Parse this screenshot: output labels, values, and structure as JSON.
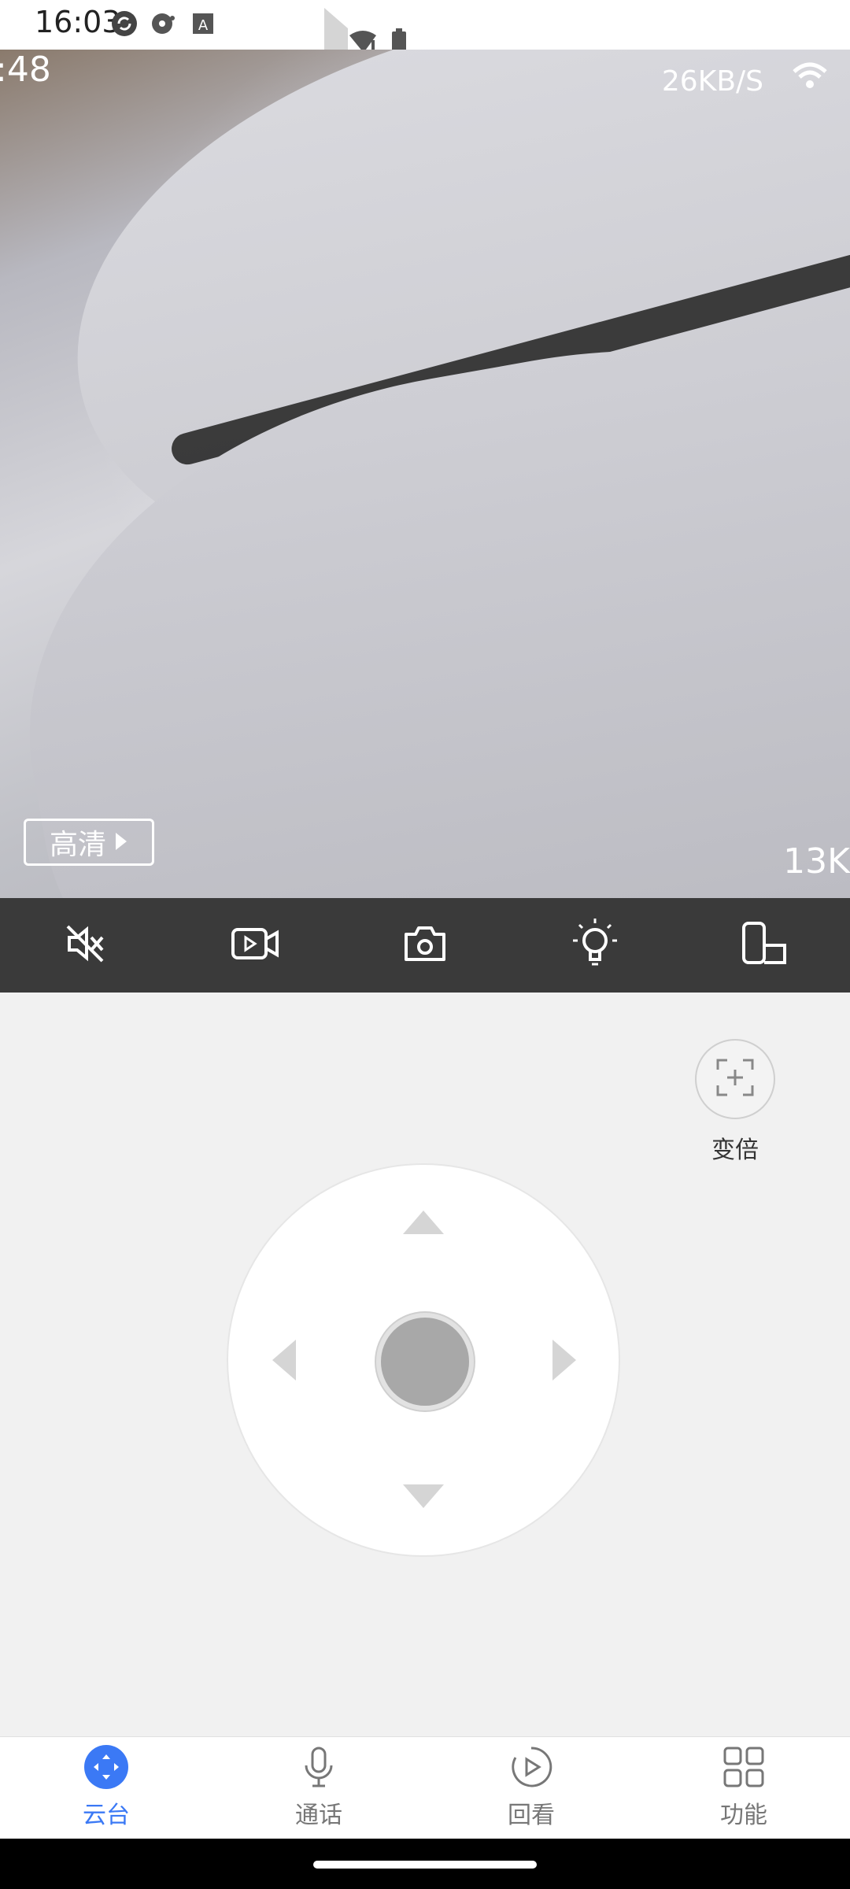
{
  "status_bar": {
    "time": "16:03",
    "icons": [
      "sync-icon",
      "media-icon",
      "font-icon"
    ],
    "right_icons": [
      "wifi-alert-icon",
      "battery-icon"
    ]
  },
  "video": {
    "timestamp": ":48",
    "net_speed": "26KB/S",
    "quality_label": "高清",
    "bitrate": "13K"
  },
  "toolbar": {
    "items": [
      {
        "name": "mute-icon"
      },
      {
        "name": "record-video-icon"
      },
      {
        "name": "camera-icon"
      },
      {
        "name": "light-icon"
      },
      {
        "name": "screen-rotate-icon"
      }
    ]
  },
  "zoom": {
    "label": "变倍"
  },
  "bottom_nav": {
    "items": [
      {
        "label": "云台",
        "icon": "ptz-icon",
        "active": true
      },
      {
        "label": "通话",
        "icon": "microphone-icon",
        "active": false
      },
      {
        "label": "回看",
        "icon": "playback-icon",
        "active": false
      },
      {
        "label": "功能",
        "icon": "grid-icon",
        "active": false
      }
    ]
  },
  "colors": {
    "accent": "#3b79f5",
    "toolbar_bg": "#3a3a3a",
    "page_bg": "#f1f1f1"
  }
}
